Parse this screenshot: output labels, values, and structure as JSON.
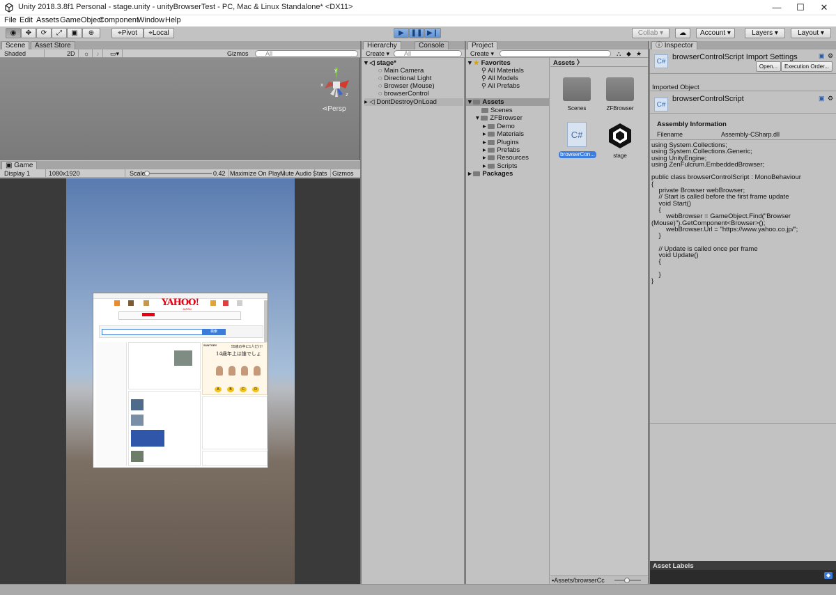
{
  "window": {
    "title": "Unity 2018.3.8f1 Personal - stage.unity - unityBrowserTest - PC, Mac & Linux Standalone* <DX11>",
    "minimize": "—",
    "maximize": "☐",
    "close": "✕"
  },
  "menu": [
    "File",
    "Edit",
    "Assets",
    "GameObject",
    "Component",
    "Window",
    "Help"
  ],
  "toolbar": {
    "pivot": "Pivot",
    "local": "Local",
    "collab": "Collab",
    "account": "Account",
    "layers": "Layers",
    "layout": "Layout"
  },
  "scene": {
    "tab_scene": "Scene",
    "tab_asset_store": "Asset Store",
    "shaded": "Shaded",
    "mode_2d": "2D",
    "gizmos": "Gizmos",
    "search_placeholder": "All",
    "persp": "Persp",
    "axis_x": "x",
    "axis_y": "y",
    "axis_z": "z"
  },
  "game": {
    "tab": "Game",
    "display": "Display 1",
    "resolution": "1080x1920",
    "scale_label": "Scale",
    "scale_value": "0.42",
    "maximize_on_play": "Maximize On Play",
    "mute_audio": "Mute Audio",
    "stats": "Stats",
    "gizmos": "Gizmos"
  },
  "hierarchy": {
    "tab": "Hierarchy",
    "tab_console": "Console",
    "create": "Create",
    "search_placeholder": "All",
    "scene_name": "stage*",
    "items": [
      "Main Camera",
      "Directional Light",
      "Browser (Mouse)",
      "browserControl"
    ],
    "dont_destroy": "DontDestroyOnLoad"
  },
  "project": {
    "tab": "Project",
    "create": "Create",
    "favorites": "Favorites",
    "favorite_items": [
      "All Materials",
      "All Models",
      "All Prefabs"
    ],
    "assets_root": "Assets",
    "tree": [
      "Scenes",
      "ZFBrowser",
      "Demo",
      "Materials",
      "Plugins",
      "Prefabs",
      "Resources",
      "Scripts",
      "Packages"
    ],
    "breadcrumb": "Assets",
    "grid": [
      "Scenes",
      "ZFBrowser",
      "browserCon...",
      "stage"
    ],
    "footer_path": "Assets/browserCc"
  },
  "inspector": {
    "tab": "Inspector",
    "header_title": "browserControlScript Import Settings",
    "open_btn": "Open...",
    "exec_order_btn": "Execution Order...",
    "imported_object": "Imported Object",
    "object_name": "browserControlScript",
    "assembly_info": "Assembly Information",
    "filename_label": "Filename",
    "filename_value": "Assembly-CSharp.dll",
    "code": "using System.Collections;\nusing System.Collections.Generic;\nusing UnityEngine;\nusing ZenFulcrum.EmbeddedBrowser;\n\npublic class browserControlScript : MonoBehaviour\n{\n    private Browser webBrowser;\n    // Start is called before the first frame update\n    void Start()\n    {\n        webBrowser = GameObject.Find(\"Browser\n(Mouse)\").GetComponent<Browser>();\n        webBrowser.Url = \"https://www.yahoo.co.jp/\";\n    }\n\n    // Update is called once per frame\n    void Update()\n    {\n\n    }\n}",
    "asset_labels": "Asset Labels"
  },
  "web": {
    "logo": "YAHOO!",
    "logo_sub": "JAPAN",
    "search_button": "検索",
    "promo_brand": "SUNTORY",
    "promo_line1": "55歳の中に1人だけ!",
    "promo_line2": "14歳年上は誰でしょ",
    "choices": [
      "A",
      "B",
      "C",
      "D"
    ]
  },
  "colors": {
    "accent": "#3d7bd9",
    "selection": "#3e7de0",
    "yahoo_red": "#e60012"
  }
}
